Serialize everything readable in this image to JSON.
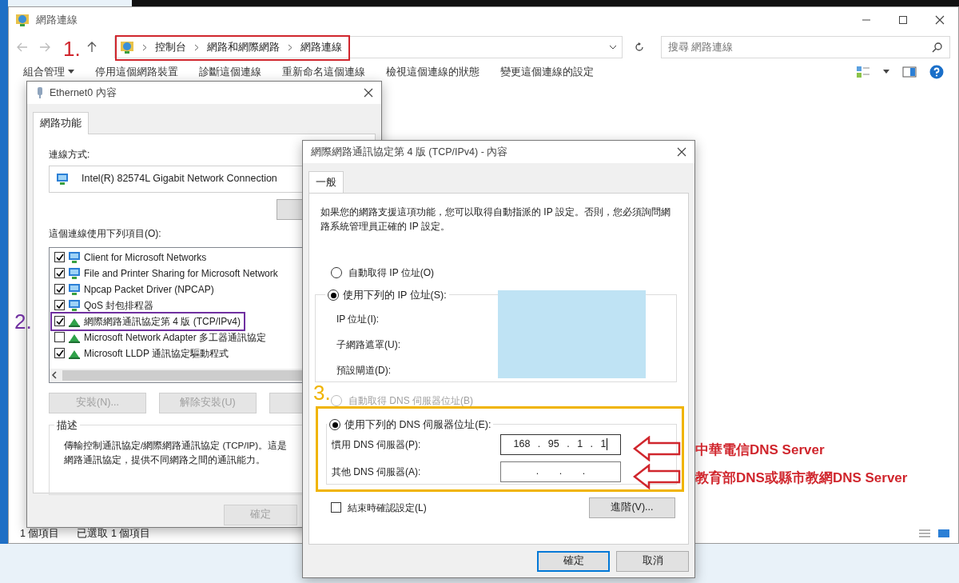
{
  "explorer": {
    "title": "網路連線",
    "breadcrumb": [
      "控制台",
      "網路和網際網路",
      "網路連線"
    ],
    "search": {
      "placeholder": "搜尋 網路連線"
    },
    "toolbar": [
      {
        "label": "組合管理",
        "kind": "menu"
      },
      {
        "label": "停用這個網路裝置",
        "kind": "command"
      },
      {
        "label": "診斷這個連線",
        "kind": "command"
      },
      {
        "label": "重新命名這個連線",
        "kind": "command"
      },
      {
        "label": "檢視這個連線的狀態",
        "kind": "command"
      },
      {
        "label": "變更這個連線的設定",
        "kind": "command"
      }
    ],
    "status_bar": [
      "1 個項目",
      "已選取 1 個項目"
    ]
  },
  "ethernet_dialog": {
    "title": "Ethernet0 內容",
    "tabs": [
      {
        "label": "網路功能",
        "selected": true
      }
    ],
    "connect_using_label": "連線方式:",
    "adapter": "Intel(R) 82574L Gigabit Network Connection",
    "items_label": "這個連線使用下列項目(O):",
    "items": [
      {
        "label": "Client for Microsoft Networks",
        "checked": true,
        "kind": "client"
      },
      {
        "label": "File and Printer Sharing for Microsoft Network",
        "checked": true,
        "kind": "client"
      },
      {
        "label": "Npcap Packet Driver (NPCAP)",
        "checked": true,
        "kind": "client"
      },
      {
        "label": "QoS 封包排程器",
        "checked": true,
        "kind": "client"
      },
      {
        "label": "網際網路通訊協定第 4 版 (TCP/IPv4)",
        "checked": true,
        "kind": "protocol"
      },
      {
        "label": "Microsoft Network Adapter 多工器通訊協定",
        "checked": false,
        "kind": "protocol"
      },
      {
        "label": "Microsoft LLDP 通訊協定驅動程式",
        "checked": true,
        "kind": "protocol"
      }
    ],
    "buttons": [
      {
        "label": "安裝(N)...",
        "disabled": true
      },
      {
        "label": "解除安裝(U)",
        "disabled": true
      }
    ],
    "description_title": "描述",
    "description_lines": [
      "傳輸控制通訊協定/網際網路通訊協定 (TCP/IP)。這是",
      "網路通訊協定，提供不同網路之間的通訊能力。"
    ],
    "ok_button": {
      "label": "確定",
      "disabled": true
    }
  },
  "ipv4_dialog": {
    "title": "網際網路通訊協定第 4 版 (TCP/IPv4) - 內容",
    "tabs": [
      {
        "label": "一般",
        "selected": true
      }
    ],
    "intro": "如果您的網路支援這項功能，您可以取得自動指派的 IP 設定。否則，您必須詢問網路系統管理員正確的 IP 設定。",
    "ip_mode": [
      {
        "label": "自動取得 IP 位址(O)",
        "selected": false
      },
      {
        "label": "使用下列的 IP 位址(S):",
        "selected": true
      }
    ],
    "ip_field_labels": [
      "IP 位址(I):",
      "子網路遮罩(U):",
      "預設閘道(D):"
    ],
    "dns_mode": [
      {
        "label": "自動取得 DNS 伺服器位址(B)",
        "selected": false,
        "disabled": true
      },
      {
        "label": "使用下列的 DNS 伺服器位址(E):",
        "selected": true,
        "disabled": false
      }
    ],
    "dns_fields": [
      {
        "label": "慣用 DNS 伺服器(P):",
        "value": "168 . 95 . 1 . 1",
        "focused": true
      },
      {
        "label": "其他 DNS 伺服器(A):",
        "value": ". . .",
        "focused": false
      }
    ],
    "validate_on_exit": {
      "label": "結束時確認設定(L)",
      "checked": false
    },
    "advanced_button": "進階(V)...",
    "buttons": [
      {
        "label": "確定",
        "default": true
      },
      {
        "label": "取消",
        "default": false
      }
    ]
  },
  "annotations": [
    {
      "label": "1.",
      "color": "#d0262d"
    },
    {
      "label": "2.",
      "color": "#7030a0"
    },
    {
      "label": "3.",
      "color": "#f0b400"
    }
  ],
  "callouts": [
    {
      "text": "中華電信DNS Server"
    },
    {
      "text": "教育部DNS或縣市教網DNS Server"
    }
  ]
}
